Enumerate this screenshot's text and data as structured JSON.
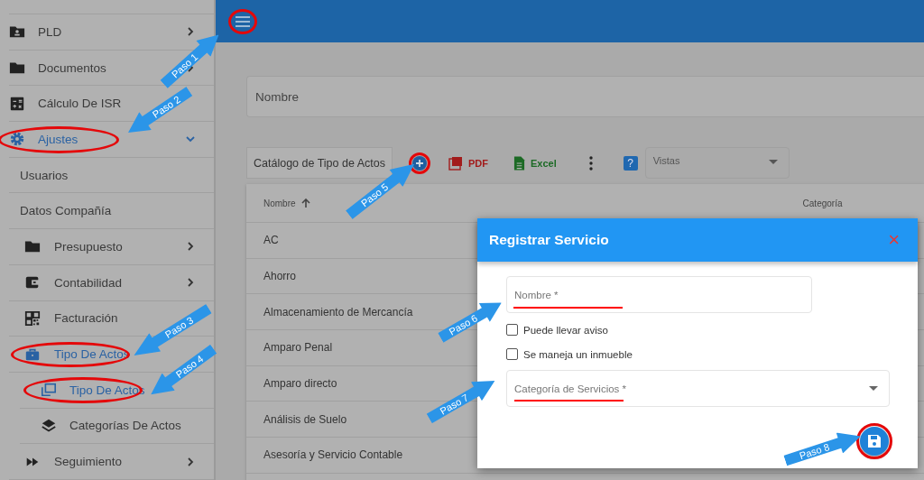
{
  "sidebar": {
    "items": [
      {
        "label": "PLD",
        "expanded": false,
        "selected": false
      },
      {
        "label": "Documentos",
        "expanded": false,
        "selected": false
      },
      {
        "label": "Cálculo De ISR",
        "selected": false
      },
      {
        "label": "Ajustes",
        "expanded": true,
        "selected": true,
        "children": [
          {
            "label": "Usuarios",
            "selected": false
          },
          {
            "label": "Datos Compañía",
            "selected": false
          },
          {
            "label": "Presupuesto",
            "expanded": false,
            "selected": false
          },
          {
            "label": "Contabilidad",
            "expanded": false,
            "selected": false
          },
          {
            "label": "Facturación",
            "selected": false
          },
          {
            "label": "Tipo De Actos",
            "selected": true,
            "children": [
              {
                "label": "Tipo De Actos",
                "selected": true
              },
              {
                "label": "Categorías De Actos",
                "selected": false
              }
            ]
          },
          {
            "label": "Seguimiento",
            "expanded": false,
            "selected": false
          }
        ]
      }
    ]
  },
  "filter": {
    "placeholder": "Nombre"
  },
  "toolbar": {
    "title": "Catálogo de Tipo de Actos",
    "pdf": "PDF",
    "excel": "Excel",
    "help": "?",
    "views": {
      "placeholder": "Vistas"
    }
  },
  "table": {
    "columns": [
      "Nombre",
      "Categoría"
    ],
    "rows": [
      "AC",
      "Ahorro",
      "Almacenamiento de Mercancía",
      "Amparo Penal",
      "Amparo directo",
      "Análisis de Suelo",
      "Asesoría y Servicio Contable"
    ]
  },
  "dialog": {
    "title": "Registrar Servicio",
    "close": "×",
    "name_field": {
      "placeholder": "Nombre *"
    },
    "checkboxes": [
      {
        "label": "Puede llevar aviso",
        "checked": false
      },
      {
        "label": "Se maneja un inmueble",
        "checked": false
      }
    ],
    "category_select": {
      "placeholder": "Categoría de Servicios *"
    }
  },
  "annotations": [
    "Paso 1",
    "Paso 2",
    "Paso 3",
    "Paso 4",
    "Paso 5",
    "Paso 6",
    "Paso 7",
    "Paso 8"
  ]
}
